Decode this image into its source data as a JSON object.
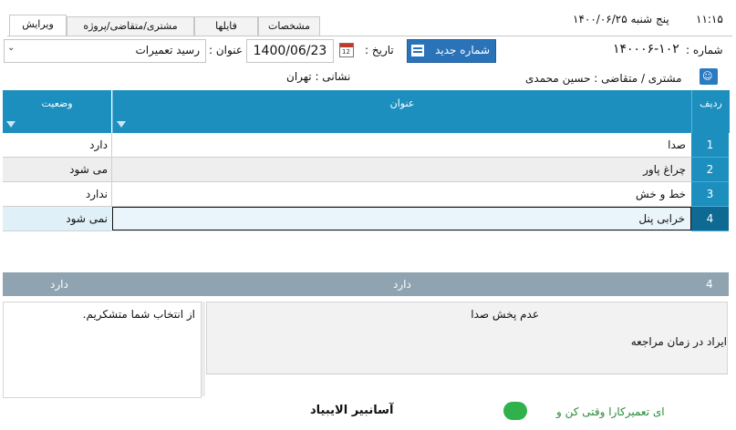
{
  "header": {
    "time": "۱۱:۱۵",
    "date": "پنج شنبه ۱۴۰۰/۰۶/۲۵"
  },
  "tabs": [
    {
      "label": "ویرایش"
    },
    {
      "label": "مشتری/متقاضی/پروژه"
    },
    {
      "label": "فایلها"
    },
    {
      "label": "مشخصات"
    }
  ],
  "form": {
    "number_label": "شماره :",
    "number_value": "۱۴۰۰۰۶-۱۰۲",
    "new_number_button": "شماره جدید",
    "date_label": "تاریخ :",
    "date_value": "1400/06/23",
    "title_label": "عنوان :",
    "title_value": "رسید تعمیرات"
  },
  "customer": {
    "label": "مشتری / متقاضی : حسین محمدی",
    "address": "نشانی : تهران"
  },
  "grid": {
    "columns": {
      "row": "ردیف",
      "title": "عنوان",
      "status": "وضعیت"
    },
    "rows": [
      {
        "num": "1",
        "title": "صدا",
        "status": "دارد"
      },
      {
        "num": "2",
        "title": "چراغ پاور",
        "status": "می شود"
      },
      {
        "num": "3",
        "title": "خط و خش",
        "status": "ندارد"
      },
      {
        "num": "4",
        "title": "خرابی پنل",
        "status": "نمی شود"
      }
    ],
    "footer": {
      "num": "4",
      "title": "دارد",
      "status": "دارد"
    }
  },
  "notes": {
    "left": "از انتخاب شما متشکریم.",
    "right_line1": "عدم پخش صدا",
    "right_line2": "ایراد در زمان مراجعه"
  },
  "bottom": {
    "text": "ای تعمیرکارا وقتی کن و",
    "text2": "آسانبیر الایبیاد"
  }
}
